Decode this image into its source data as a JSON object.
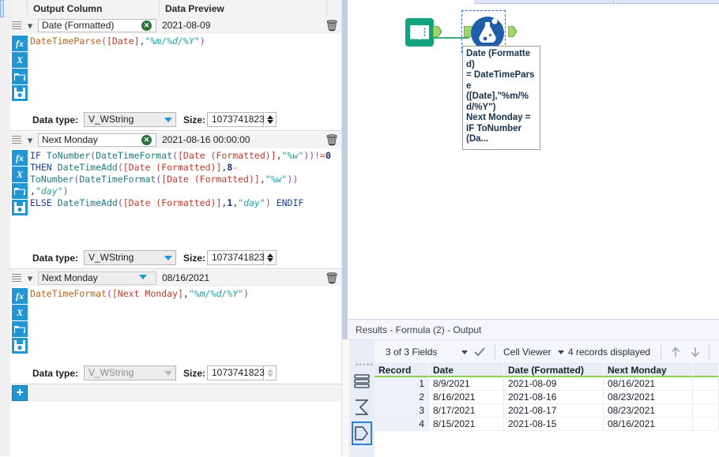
{
  "config": {
    "headers": [
      "",
      "Output Column",
      "Data Preview",
      ""
    ],
    "add_label": "+",
    "toolstrip": [
      "fx",
      "X",
      "open-folder",
      "save"
    ],
    "rows": [
      {
        "name": "Date (Formatted)",
        "preview": "2021-08-09",
        "formula": "DateTimeParse([Date],\"%m/%d/%Y\")",
        "datatype_label": "Data type:",
        "datatype_value": "V_WString",
        "size_label": "Size:",
        "size_value": "1073741823",
        "control": "clear"
      },
      {
        "name": "Next Monday",
        "preview": "2021-08-16 00:00:00",
        "formula": "IF ToNumber(DateTimeFormat([Date (Formatted)],\"%w\"))!=0 THEN DateTimeAdd([Date (Formatted)],8-ToNumber(DateTimeFormat([Date (Formatted)],\"%w\")),\"day\") ELSE DateTimeAdd([Date (Formatted)],1,\"day\") ENDIF",
        "datatype_label": "Data type:",
        "datatype_value": "V_WString",
        "size_label": "Size:",
        "size_value": "1073741823",
        "control": "clear"
      },
      {
        "name": "Next Monday",
        "preview": "08/16/2021",
        "formula": "DateTimeFormat([Next Monday],\"%m/%d/%Y\")",
        "datatype_label": "Data type:",
        "datatype_value": "V_WString",
        "size_label": "Size:",
        "size_value": "1073741823",
        "control": "dropdown"
      }
    ]
  },
  "canvas": {
    "input_node_icon": "book-icon",
    "formula_node_icon": "flask-icon",
    "tooltip_lines": [
      "Date (Formatted)",
      "= DateTimeParse",
      "([Date],\"%m/%",
      "d/%Y\")",
      "Next Monday =",
      "IF ToNumber",
      "(Da..."
    ],
    "wire_color": "#3aaa7a",
    "input_node_color": "#12a37f",
    "formula_node_color": "#1f5fa9"
  },
  "results": {
    "title": "Results - Formula (2) - Output",
    "toolbar": {
      "fields": "3 of 3 Fields",
      "viewer": "Cell Viewer",
      "records": "4 records displayed"
    },
    "rail_icons": [
      "layers-icon",
      "sigma-icon",
      "output-anchor-icon"
    ],
    "grid": {
      "columns": [
        "Record",
        "Date",
        "Date (Formatted)",
        "Next Monday",
        ""
      ],
      "rows": [
        [
          "1",
          "8/9/2021",
          "2021-08-09",
          "08/16/2021",
          ""
        ],
        [
          "2",
          "8/16/2021",
          "2021-08-16",
          "08/23/2021",
          ""
        ],
        [
          "3",
          "8/17/2021",
          "2021-08-17",
          "08/23/2021",
          ""
        ],
        [
          "4",
          "8/15/2021",
          "2021-08-15",
          "08/16/2021",
          ""
        ]
      ]
    },
    "accent_green": "#8fd14f"
  }
}
